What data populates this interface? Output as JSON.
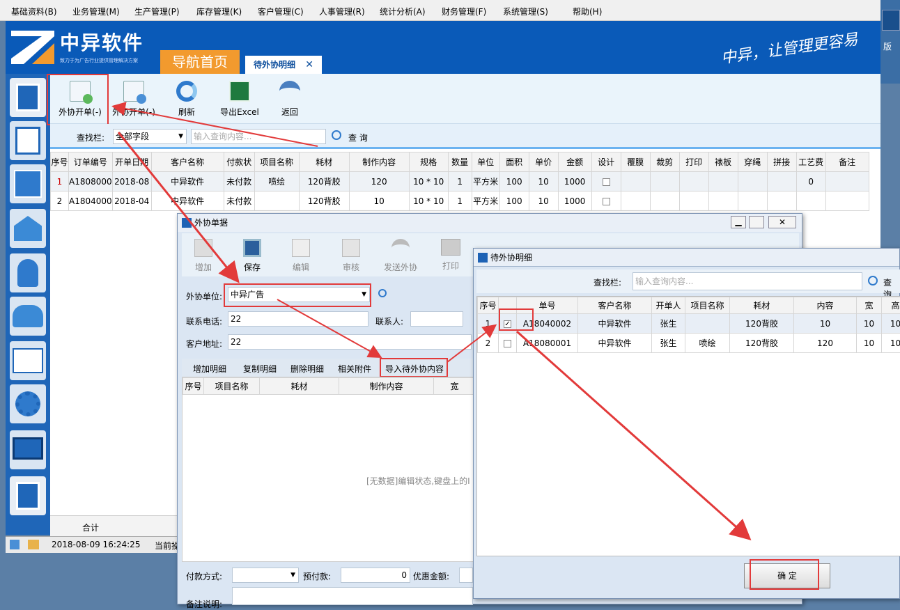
{
  "menu": [
    "基础资料(B)",
    "业务管理(M)",
    "生产管理(P)",
    "库存管理(K)",
    "客户管理(C)",
    "人事管理(R)",
    "统计分析(A)",
    "财务管理(F)",
    "系统管理(S)",
    "帮助(H)"
  ],
  "brand": {
    "name": "中异软件",
    "tagline": "致力于为广告行业提供管理解决方案",
    "slogan": "中异，让管理更容易"
  },
  "desktop_label": "版",
  "tabs": {
    "home": "导航首页",
    "current": "待外协明细",
    "close": "✕"
  },
  "toolbar": [
    "外协开单(-)",
    "外协开单(-)",
    "刷新",
    "导出Excel",
    "返回"
  ],
  "search": {
    "label": "查找栏:",
    "field": "全部字段",
    "placeholder": "输入查询内容...",
    "button": "查 询"
  },
  "main_table": {
    "headers": [
      "序号",
      "订单编号",
      "开单日期",
      "客户名称",
      "付款状",
      "项目名称",
      "耗材",
      "制作内容",
      "规格",
      "数量",
      "单位",
      "面积",
      "单价",
      "金额",
      "设计",
      "覆膜",
      "裁剪",
      "打印",
      "裱板",
      "穿绳",
      "拼接",
      "工艺费",
      "备注"
    ],
    "rows": [
      [
        "1",
        "A1808000",
        "2018-08",
        "中异软件",
        "未付款",
        "喷绘",
        "120背胶",
        "120",
        "10 * 10",
        "1",
        "平方米",
        "100",
        "10",
        "1000",
        "",
        "",
        "",
        "",
        "",
        "",
        "",
        "0",
        ""
      ],
      [
        "2",
        "A1804000",
        "2018-04",
        "中异软件",
        "未付款",
        "",
        "120背胶",
        "10",
        "10 * 10",
        "1",
        "平方米",
        "100",
        "10",
        "1000",
        "",
        "",
        "",
        "",
        "",
        "",
        "",
        "",
        ""
      ]
    ]
  },
  "footer": {
    "total": "合计",
    "datetime": "2018-08-09 16:24:25",
    "current": "当前操"
  },
  "win1": {
    "title": "外协单据",
    "tools": [
      "增加",
      "保存",
      "编辑",
      "审核",
      "发送外协",
      "打印"
    ],
    "unit_label": "外协单位:",
    "unit_value": "中异广告",
    "phone_label": "联系电话:",
    "phone_value": "22",
    "contact_label": "联系人:",
    "addr_label": "客户地址:",
    "addr_value": "22",
    "subtabs": [
      "增加明细",
      "复制明细",
      "删除明细",
      "相关附件",
      "导入待外协内容"
    ],
    "detail_headers": [
      "序号",
      "项目名称",
      "耗材",
      "制作内容",
      "宽"
    ],
    "empty": "[无数据]编辑状态,键盘上的I",
    "pay_label": "付款方式:",
    "prepay_label": "预付款:",
    "prepay_value": "0",
    "discount_label": "优惠金额:",
    "note_label": "备注说明:"
  },
  "win2": {
    "title": "待外协明细",
    "search_label": "查找栏:",
    "placeholder": "输入查询内容...",
    "search_btn": "查 询",
    "headers": [
      "序号",
      "",
      "单号",
      "客户名称",
      "开单人",
      "项目名称",
      "耗材",
      "内容",
      "宽",
      "高"
    ],
    "rows": [
      [
        "1",
        "✓",
        "A18040002",
        "中异软件",
        "张生",
        "",
        "120背胶",
        "10",
        "10",
        "10"
      ],
      [
        "2",
        "",
        "A18080001",
        "中异软件",
        "张生",
        "喷绘",
        "120背胶",
        "120",
        "10",
        "10"
      ]
    ],
    "confirm": "确 定"
  },
  "colors": {
    "accent": "#0a5ab8",
    "orange": "#f29a2e",
    "highlight": "#e23a3a"
  }
}
